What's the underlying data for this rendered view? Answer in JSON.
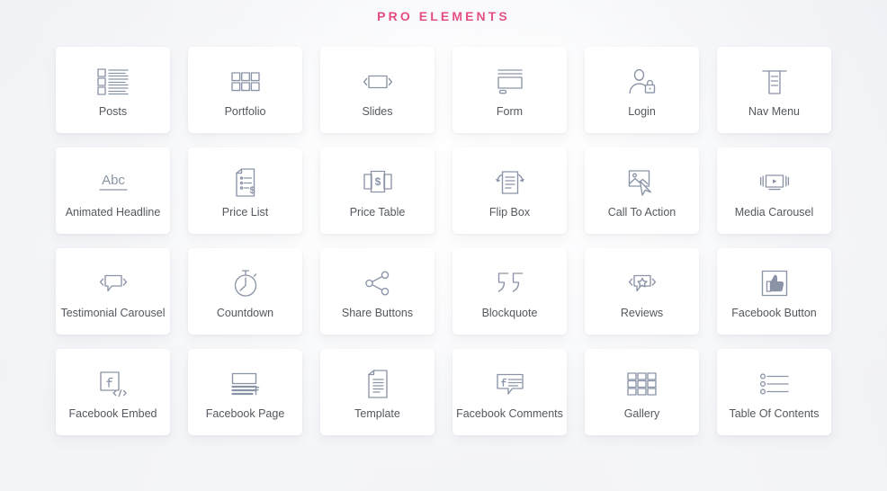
{
  "header": {
    "title": "PRO ELEMENTS",
    "accent_color": "#e2487e"
  },
  "theme": {
    "card_background": "#ffffff",
    "icon_color": "#8a94a6",
    "label_color": "#54595f",
    "page_background": "#f6f7f9"
  },
  "elements": [
    {
      "label": "Posts",
      "icon": "posts-icon"
    },
    {
      "label": "Portfolio",
      "icon": "portfolio-grid-icon"
    },
    {
      "label": "Slides",
      "icon": "slides-icon"
    },
    {
      "label": "Form",
      "icon": "form-icon"
    },
    {
      "label": "Login",
      "icon": "login-user-lock-icon"
    },
    {
      "label": "Nav Menu",
      "icon": "nav-menu-icon"
    },
    {
      "label": "Animated Headline",
      "icon": "animated-headline-abc-icon"
    },
    {
      "label": "Price List",
      "icon": "price-list-icon"
    },
    {
      "label": "Price Table",
      "icon": "price-table-icon"
    },
    {
      "label": "Flip Box",
      "icon": "flip-box-icon"
    },
    {
      "label": "Call To Action",
      "icon": "call-to-action-cursor-icon"
    },
    {
      "label": "Media Carousel",
      "icon": "media-carousel-play-icon"
    },
    {
      "label": "Testimonial Carousel",
      "icon": "testimonial-carousel-bubble-icon"
    },
    {
      "label": "Countdown",
      "icon": "countdown-stopwatch-icon"
    },
    {
      "label": "Share Buttons",
      "icon": "share-nodes-icon"
    },
    {
      "label": "Blockquote",
      "icon": "blockquote-quotes-icon"
    },
    {
      "label": "Reviews",
      "icon": "reviews-star-bubble-icon"
    },
    {
      "label": "Facebook Button",
      "icon": "facebook-thumbs-up-icon"
    },
    {
      "label": "Facebook Embed",
      "icon": "facebook-embed-code-icon"
    },
    {
      "label": "Facebook Page",
      "icon": "facebook-page-icon"
    },
    {
      "label": "Template",
      "icon": "template-document-icon"
    },
    {
      "label": "Facebook Comments",
      "icon": "facebook-comments-bubble-icon"
    },
    {
      "label": "Gallery",
      "icon": "gallery-grid-icon"
    },
    {
      "label": "Table Of Contents",
      "icon": "table-of-contents-icon"
    }
  ]
}
